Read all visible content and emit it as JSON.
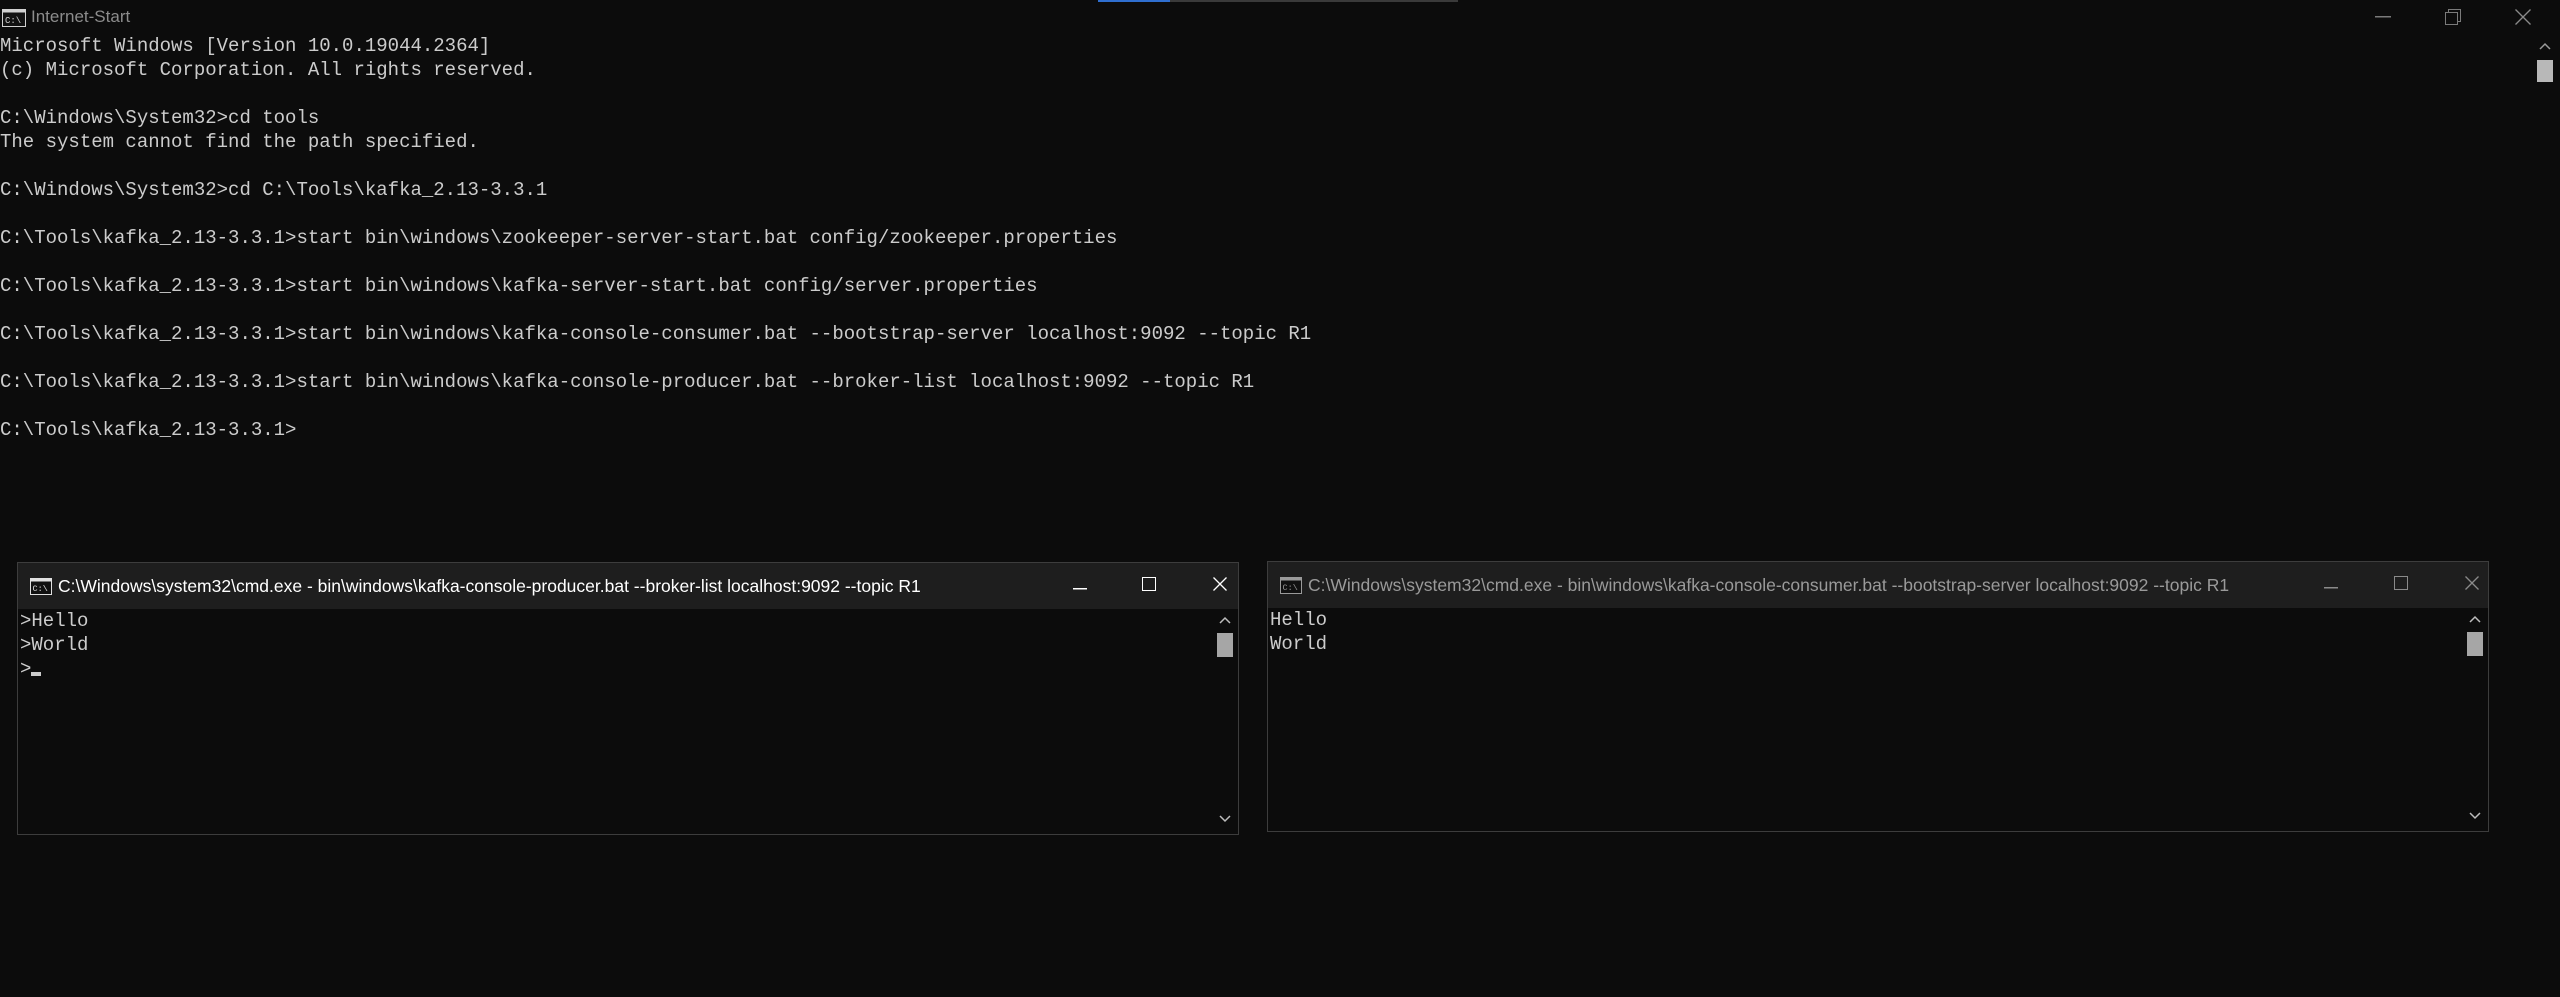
{
  "window": {
    "title": "Internet-Start",
    "icon": "cmd-icon",
    "controls": [
      "minimize-icon",
      "restore-icon",
      "close-icon"
    ]
  },
  "console": {
    "lines": [
      "Microsoft Windows [Version 10.0.19044.2364]",
      "(c) Microsoft Corporation. All rights reserved.",
      "",
      "C:\\Windows\\System32>cd tools",
      "The system cannot find the path specified.",
      "",
      "C:\\Windows\\System32>cd C:\\Tools\\kafka_2.13-3.3.1",
      "",
      "C:\\Tools\\kafka_2.13-3.3.1>start bin\\windows\\zookeeper-server-start.bat config/zookeeper.properties",
      "",
      "C:\\Tools\\kafka_2.13-3.3.1>start bin\\windows\\kafka-server-start.bat config/server.properties",
      "",
      "C:\\Tools\\kafka_2.13-3.3.1>start bin\\windows\\kafka-console-consumer.bat --bootstrap-server localhost:9092 --topic R1",
      "",
      "C:\\Tools\\kafka_2.13-3.3.1>start bin\\windows\\kafka-console-producer.bat --broker-list localhost:9092 --topic R1",
      "",
      "C:\\Tools\\kafka_2.13-3.3.1>"
    ]
  },
  "producer": {
    "title": "C:\\Windows\\system32\\cmd.exe - bin\\windows\\kafka-console-producer.bat   --broker-list localhost:9092 --topic R1",
    "lines": [
      ">Hello",
      ">World",
      ">"
    ],
    "active": true
  },
  "consumer": {
    "title": "C:\\Windows\\system32\\cmd.exe - bin\\windows\\kafka-console-consumer.bat   --bootstrap-server localhost:9092 --topic R1",
    "lines": [
      "Hello",
      "World"
    ],
    "active": false
  },
  "colors": {
    "background": "#0c0c0c",
    "text": "#cccccc",
    "titlebar_inactive": "#1e1e1e",
    "accent": "#2f6fd0"
  }
}
